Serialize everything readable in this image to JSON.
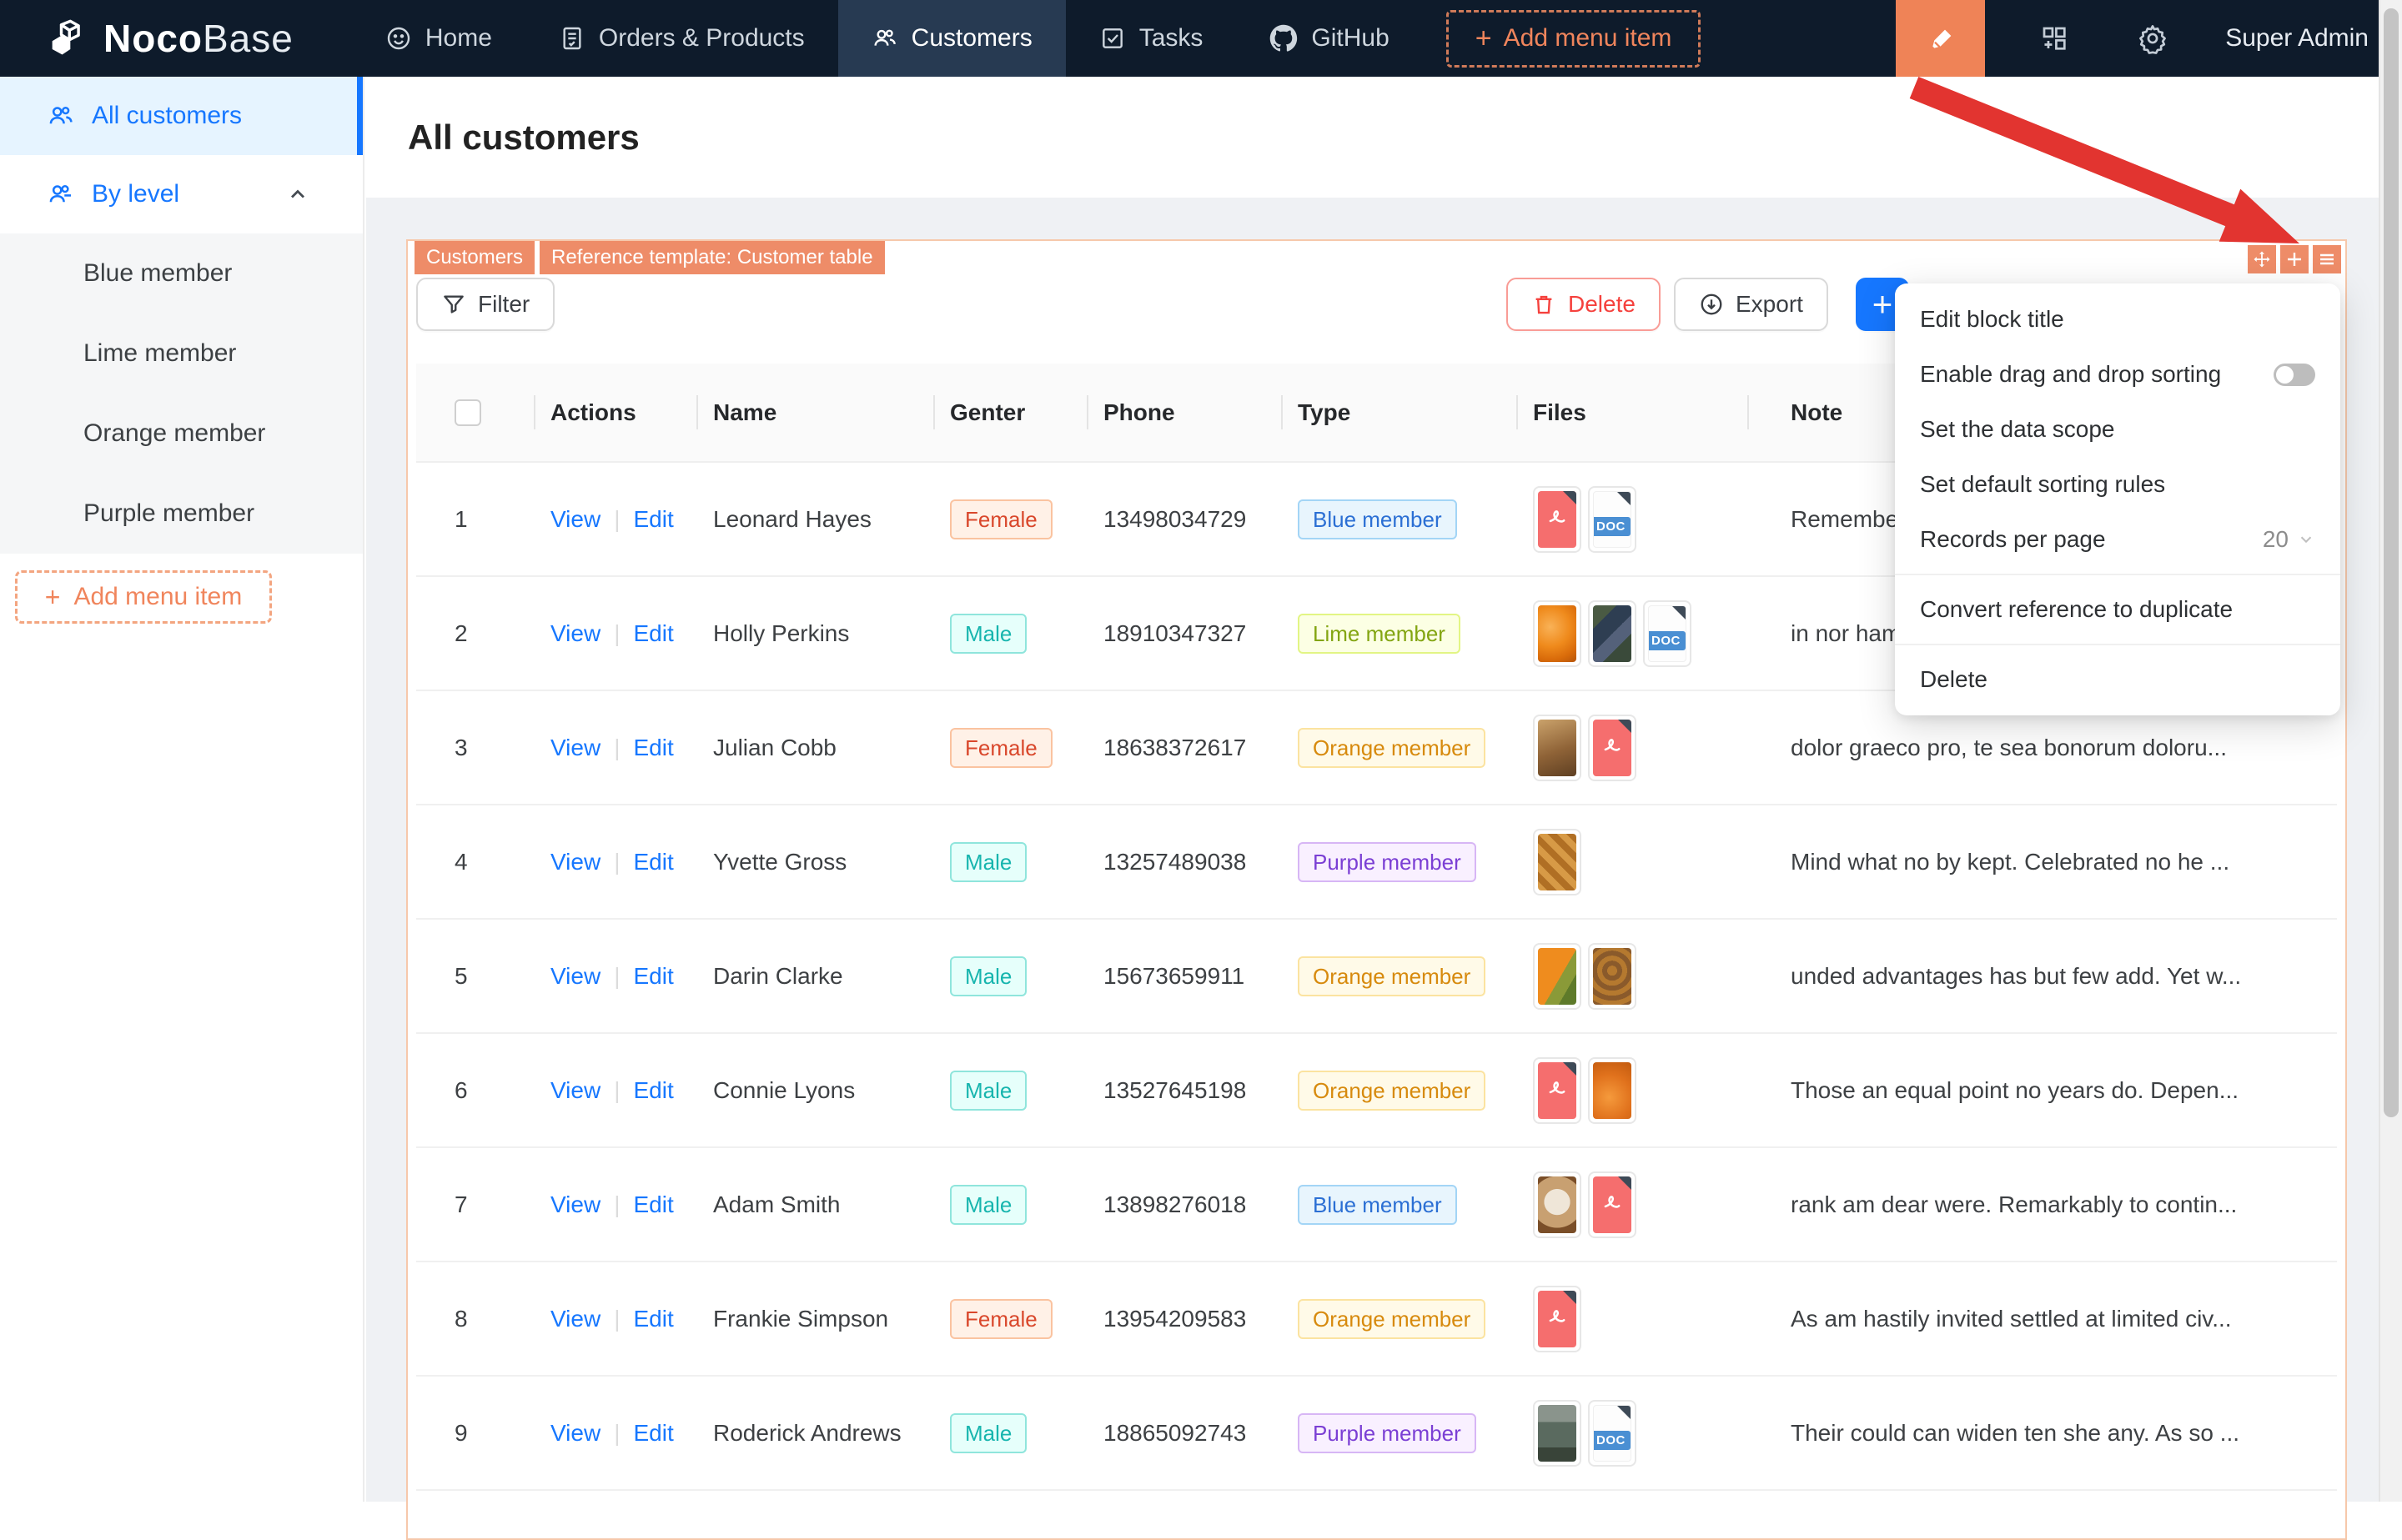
{
  "navbar": {
    "logo_primary": "Noco",
    "logo_secondary": "Base",
    "items": [
      {
        "label": "Home",
        "icon": "smile-icon",
        "active": false
      },
      {
        "label": "Orders & Products",
        "icon": "orders-icon",
        "active": false
      },
      {
        "label": "Customers",
        "icon": "team-icon",
        "active": true
      },
      {
        "label": "Tasks",
        "icon": "check-square-icon",
        "active": false
      },
      {
        "label": "GitHub",
        "icon": "github-icon",
        "active": false
      }
    ],
    "add_menu_item": "Add menu item",
    "user": "Super Admin"
  },
  "sidebar": {
    "all_customers": "All customers",
    "by_level": "By level",
    "sub_items": [
      "Blue member",
      "Lime member",
      "Orange member",
      "Purple member"
    ],
    "add_menu_item": "Add menu item"
  },
  "page": {
    "title": "All customers"
  },
  "block": {
    "tags": [
      "Customers",
      "Reference template: Customer table"
    ]
  },
  "toolbar": {
    "filter": "Filter",
    "delete": "Delete",
    "export": "Export",
    "add": "+"
  },
  "context_menu": {
    "edit_block_title": "Edit block title",
    "enable_drag": "Enable drag and drop sorting",
    "drag_enabled": false,
    "set_data_scope": "Set the data scope",
    "set_sorting_rules": "Set default sorting rules",
    "records_per_page_label": "Records per page",
    "records_per_page_value": "20",
    "convert": "Convert reference to duplicate",
    "delete": "Delete"
  },
  "table": {
    "headers": {
      "actions": "Actions",
      "name": "Name",
      "gender": "Genter",
      "phone": "Phone",
      "type": "Type",
      "files": "Files",
      "note": "Note"
    },
    "action_view": "View",
    "action_edit": "Edit",
    "doc_label": "DOC",
    "rows": [
      {
        "index": "1",
        "name": "Leonard Hayes",
        "gender": {
          "label": "Female",
          "scheme": "volcano"
        },
        "phone": "13498034729",
        "type": {
          "label": "Blue member",
          "scheme": "blue"
        },
        "files": [
          {
            "kind": "pdf"
          },
          {
            "kind": "doc"
          }
        ],
        "note": "Remember"
      },
      {
        "index": "2",
        "name": "Holly Perkins",
        "gender": {
          "label": "Male",
          "scheme": "cyan"
        },
        "phone": "18910347327",
        "type": {
          "label": "Lime member",
          "scheme": "lime"
        },
        "files": [
          {
            "kind": "img",
            "look": "orange"
          },
          {
            "kind": "img",
            "look": "berries"
          },
          {
            "kind": "doc"
          }
        ],
        "note": "in nor ham"
      },
      {
        "index": "3",
        "name": "Julian Cobb",
        "gender": {
          "label": "Female",
          "scheme": "volcano"
        },
        "phone": "18638372617",
        "type": {
          "label": "Orange member",
          "scheme": "orange"
        },
        "files": [
          {
            "kind": "img",
            "look": "platter"
          },
          {
            "kind": "pdf"
          }
        ],
        "note": "dolor graeco pro, te sea bonorum doloru..."
      },
      {
        "index": "4",
        "name": "Yvette Gross",
        "gender": {
          "label": "Male",
          "scheme": "cyan"
        },
        "phone": "13257489038",
        "type": {
          "label": "Purple member",
          "scheme": "purple"
        },
        "files": [
          {
            "kind": "img",
            "look": "waffle"
          }
        ],
        "note": "Mind what no by kept. Celebrated no he ..."
      },
      {
        "index": "5",
        "name": "Darin Clarke",
        "gender": {
          "label": "Male",
          "scheme": "cyan"
        },
        "phone": "15673659911",
        "type": {
          "label": "Orange member",
          "scheme": "orange"
        },
        "files": [
          {
            "kind": "img",
            "look": "veg"
          },
          {
            "kind": "img",
            "look": "pretzel"
          }
        ],
        "note": "unded advantages has but few add. Yet w..."
      },
      {
        "index": "6",
        "name": "Connie Lyons",
        "gender": {
          "label": "Male",
          "scheme": "cyan"
        },
        "phone": "13527645198",
        "type": {
          "label": "Orange member",
          "scheme": "orange"
        },
        "files": [
          {
            "kind": "pdf"
          },
          {
            "kind": "img",
            "look": "orange2"
          }
        ],
        "note": "Those an equal point no years do. Depen..."
      },
      {
        "index": "7",
        "name": "Adam Smith",
        "gender": {
          "label": "Male",
          "scheme": "cyan"
        },
        "phone": "13898276018",
        "type": {
          "label": "Blue member",
          "scheme": "blue"
        },
        "files": [
          {
            "kind": "img",
            "look": "latte"
          },
          {
            "kind": "pdf"
          }
        ],
        "note": "rank am dear were. Remarkably to contin..."
      },
      {
        "index": "8",
        "name": "Frankie Simpson",
        "gender": {
          "label": "Female",
          "scheme": "volcano"
        },
        "phone": "13954209583",
        "type": {
          "label": "Orange member",
          "scheme": "orange"
        },
        "files": [
          {
            "kind": "pdf"
          }
        ],
        "note": "As am hastily invited settled at limited civ..."
      },
      {
        "index": "9",
        "name": "Roderick Andrews",
        "gender": {
          "label": "Male",
          "scheme": "cyan"
        },
        "phone": "18865092743",
        "type": {
          "label": "Purple member",
          "scheme": "purple"
        },
        "files": [
          {
            "kind": "img",
            "look": "store"
          },
          {
            "kind": "doc"
          }
        ],
        "note": "Their could can widen ten she any. As so ..."
      }
    ]
  },
  "colors": {
    "navbar_bg": "#0e1b2b",
    "accent_orange": "#ee8c68",
    "primary_blue": "#1677ff",
    "danger_red": "#f5413d",
    "arrow_red": "#e23430"
  }
}
